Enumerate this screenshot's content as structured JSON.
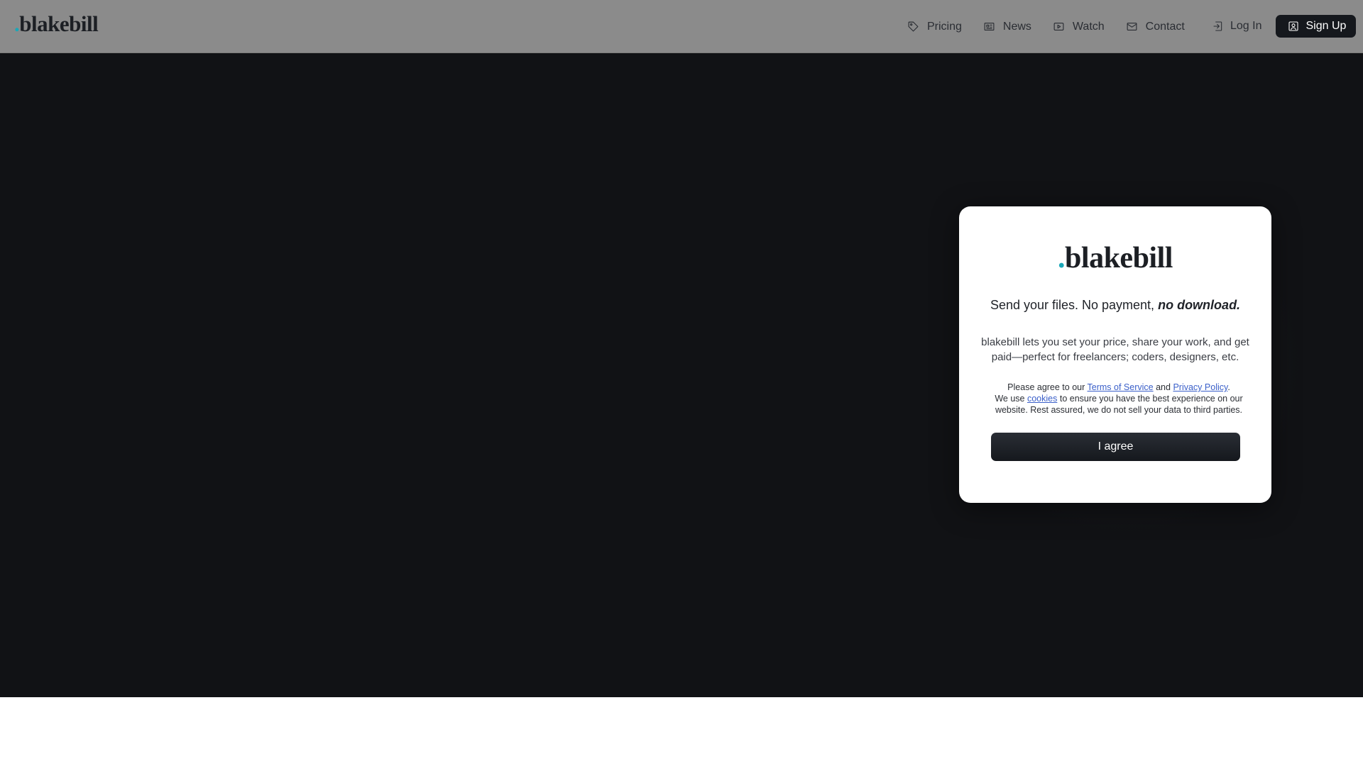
{
  "header": {
    "logo_dot": ".",
    "logo_text": "blakebill",
    "nav": {
      "pricing": "Pricing",
      "news": "News",
      "watch": "Watch",
      "contact": "Contact"
    },
    "login": "Log In",
    "signup": "Sign Up"
  },
  "modal": {
    "logo_dot": ".",
    "logo_text": "blakebill",
    "headline_plain": "Send your files. No payment,",
    "headline_emph": "no download.",
    "description": "blakebill lets you set your price, share your work, and get paid—perfect for freelancers; coders, designers, etc.",
    "legal": {
      "line1_prefix": "Please agree to our",
      "terms_link": "Terms of Service",
      "and": "and",
      "privacy_link": "Privacy Policy",
      "period": ".",
      "line2_prefix": "We use",
      "cookies_link": "cookies",
      "line2_suffix": "to ensure you have the best experience on our website. Rest assured, we do not sell your data to third parties."
    },
    "agree_button": "I agree"
  },
  "colors": {
    "header_bg": "#8b8b8b",
    "backdrop": "#111215",
    "accent_dot": "#1aa7b8",
    "primary_button": "#15181d",
    "link": "#3a5fc9"
  },
  "icons": {
    "pricing": "tag-icon",
    "news": "newspaper-icon",
    "watch": "play-icon",
    "contact": "mail-icon",
    "login": "login-icon",
    "signup": "user-square-icon"
  }
}
